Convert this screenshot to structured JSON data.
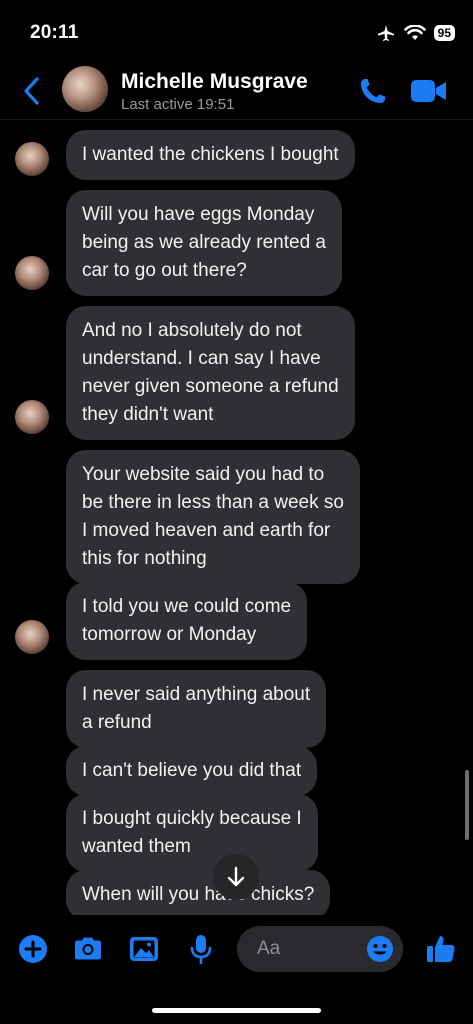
{
  "status_bar": {
    "time": "20:11",
    "battery": "95"
  },
  "header": {
    "contact_name": "Michelle Musgrave",
    "last_active": "Last active 19:51",
    "accent_color": "#1b7cf5"
  },
  "messages": [
    {
      "text": "I wanted the chickens I bought"
    },
    {
      "text": "Will you have eggs Monday\nbeing as we already rented a\ncar to go out there?"
    },
    {
      "text": "And no I absolutely do not\nunderstand. I can say I have\nnever given someone a refund\nthey didn't want"
    },
    {
      "text": "Your website said you had to\nbe there in less than a week so\nI moved heaven and earth for\nthis for nothing"
    },
    {
      "text": "I told you we could come\ntomorrow or Monday"
    },
    {
      "text": "I never said anything about\na refund"
    },
    {
      "text": "I can't believe you did that"
    },
    {
      "text": "I bought quickly because I\nwanted them"
    },
    {
      "text": "When will you have chicks?"
    }
  ],
  "composer": {
    "placeholder": "Aa",
    "icons": [
      "plus-icon",
      "camera-icon",
      "image-icon",
      "microphone-icon",
      "emoji-icon",
      "thumbs-up-icon"
    ]
  }
}
